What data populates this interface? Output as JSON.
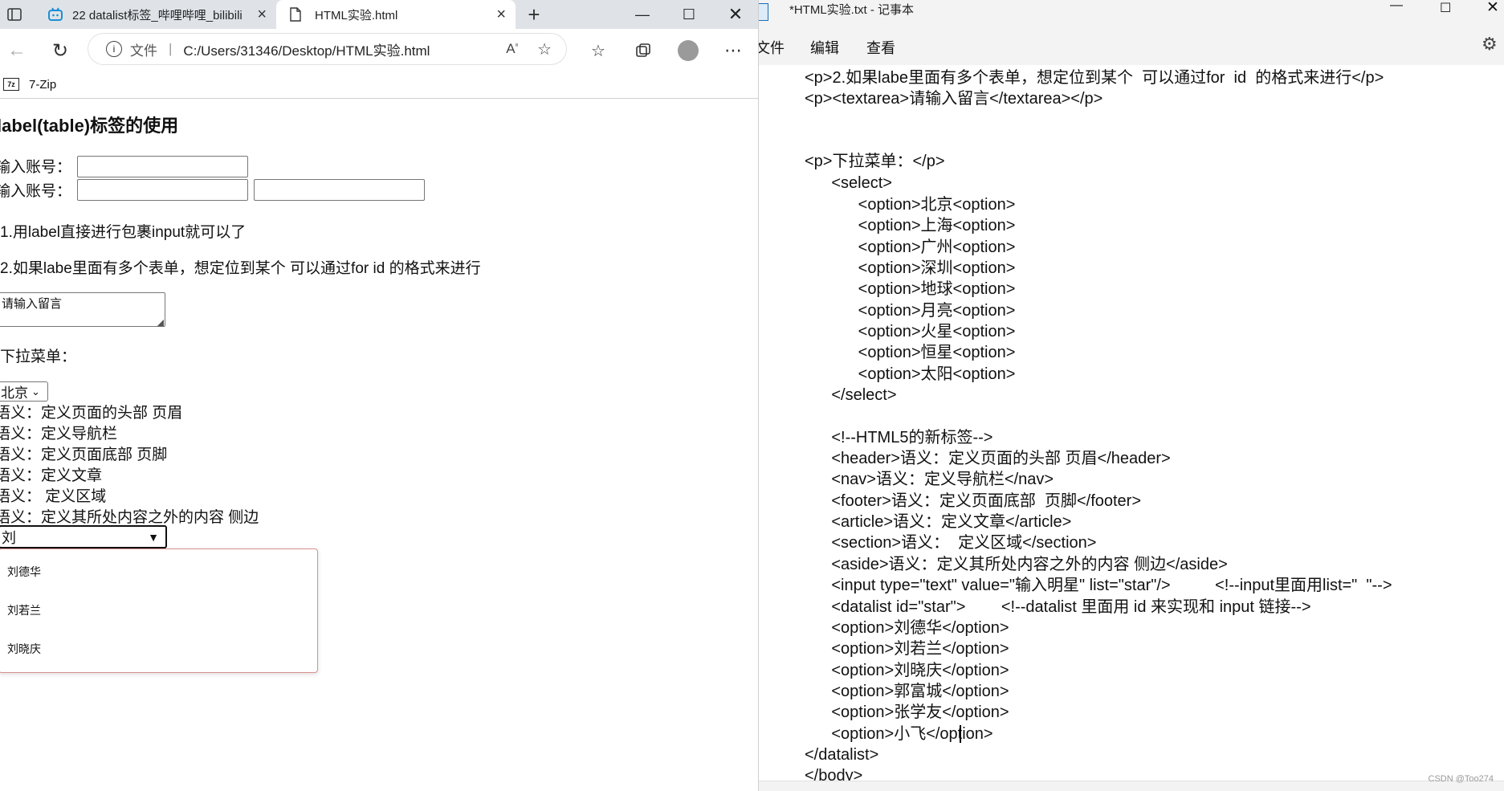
{
  "browser": {
    "tabs": [
      {
        "title": "22 datalist标签_哔哩哔哩_bilibili"
      },
      {
        "title": "HTML实验.html"
      }
    ],
    "address": {
      "scheme_label": "文件",
      "url": "C:/Users/31346/Desktop/HTML实验.html"
    },
    "bookmarks": [
      {
        "label": "7-Zip"
      }
    ],
    "page": {
      "heading": "label(table)标签的使用",
      "account_label_1": "输入账号：",
      "account_label_2": "输入账号：",
      "p1": "1.用label直接进行包裹input就可以了",
      "p2": "2.如果labe里面有多个表单，想定位到某个 可以通过for id 的格式来进行",
      "textarea_value": "请输入留言",
      "dropdown_label": "下拉菜单：",
      "select_value": "北京",
      "semantics": [
        "语义：定义页面的头部 页眉",
        "语义：定义导航栏",
        "语义：定义页面底部 页脚",
        "语义：定义文章",
        "语义： 定义区域",
        "语义：定义其所处内容之外的内容 侧边"
      ],
      "datalist_input_value": "刘",
      "datalist_options": [
        "刘德华",
        "刘若兰",
        "刘晓庆"
      ]
    }
  },
  "notepad": {
    "title": "*HTML实验.txt - 记事本",
    "menu": [
      "文件",
      "编辑",
      "查看"
    ],
    "lines": [
      "<p>2.如果labe里面有多个表单，想定位到某个  可以通过for  id  的格式来进行</p>",
      "<p><textarea>请输入留言</textarea></p>",
      "",
      "",
      "<p>下拉菜单：</p>",
      "      <select>",
      "            <option>北京<option>",
      "            <option>上海<option>",
      "            <option>广州<option>",
      "            <option>深圳<option>",
      "            <option>地球<option>",
      "            <option>月亮<option>",
      "            <option>火星<option>",
      "            <option>恒星<option>",
      "            <option>太阳<option>",
      "      </select>",
      "",
      "      <!--HTML5的新标签-->",
      "      <header>语义：定义页面的头部 页眉</header>",
      "      <nav>语义：定义导航栏</nav>",
      "      <footer>语义：定义页面底部  页脚</footer>",
      "      <article>语义：定义文章</article>",
      "      <section>语义：  定义区域</section>",
      "      <aside>语义：定义其所处内容之外的内容 侧边</aside>",
      "      <input type=\"text\" value=\"输入明星\" list=\"star\"/>          <!--input里面用list=\"  \"-->",
      "      <datalist id=\"star\">        <!--datalist 里面用 id 来实现和 input 链接-->",
      "      <option>刘德华</option>",
      "      <option>刘若兰</option>",
      "      <option>刘晓庆</option>",
      "      <option>郭富城</option>",
      "      <option>张学友</option>",
      "      <option>小飞</option>",
      "</datalist>",
      "</body>"
    ],
    "watermark": "CSDN @Too274"
  }
}
